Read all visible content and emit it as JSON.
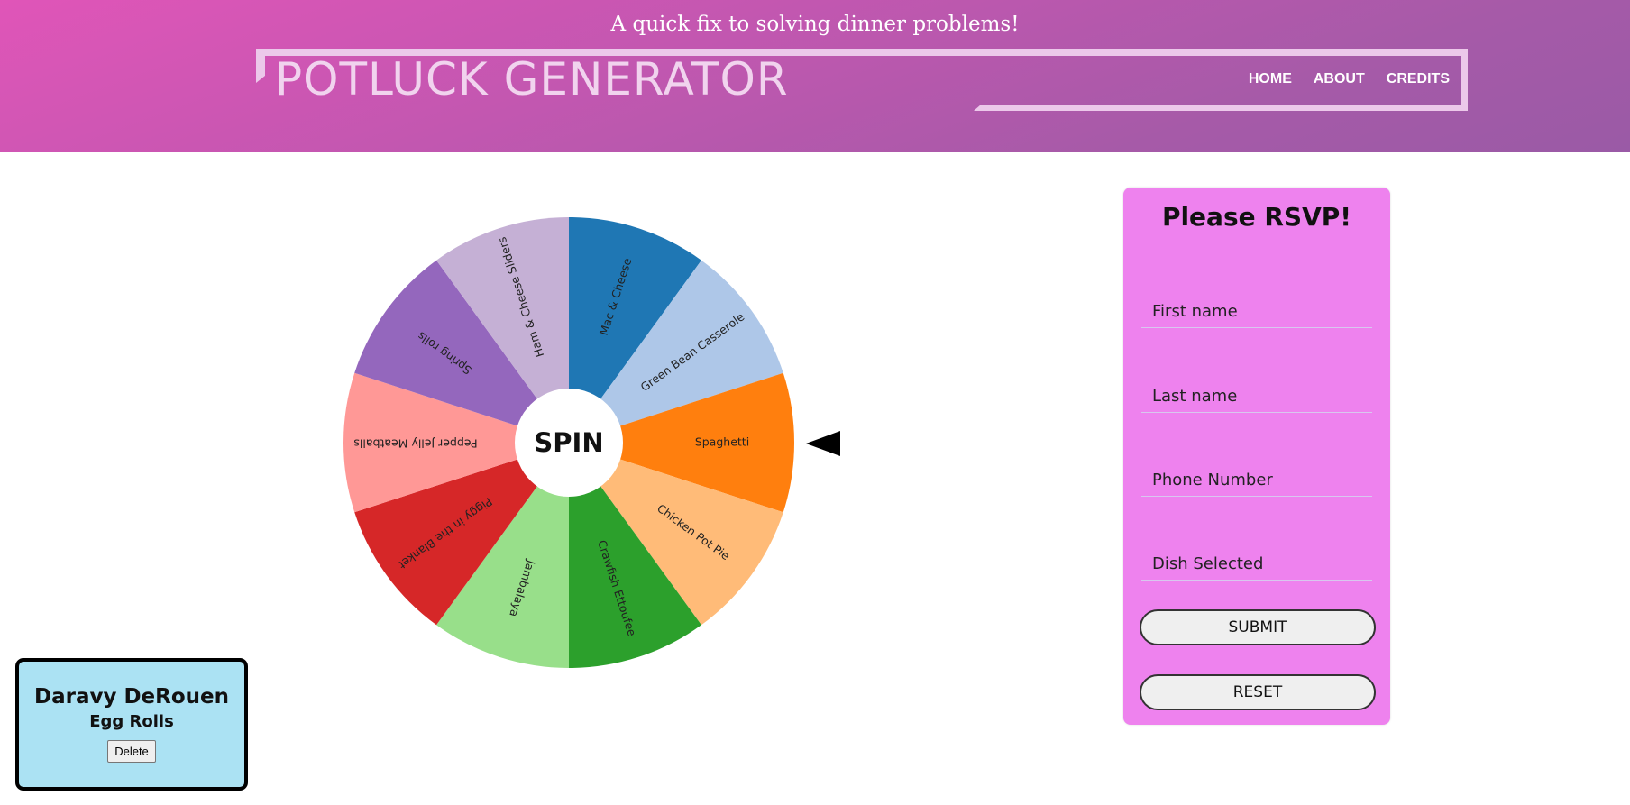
{
  "header": {
    "tagline": "A quick fix to solving dinner problems!",
    "brand": "POTLUCK GENERATOR",
    "nav": [
      "HOME",
      "ABOUT",
      "CREDITS"
    ]
  },
  "wheel": {
    "spin_label": "SPIN",
    "slices": [
      {
        "label": "Mac & Cheese",
        "color": "#1f77b4"
      },
      {
        "label": "Green Bean Casserole",
        "color": "#aec7e8"
      },
      {
        "label": "Spaghetti",
        "color": "#ff7f0e"
      },
      {
        "label": "Chicken Pot Pie",
        "color": "#ffbb78"
      },
      {
        "label": "Crawfish Ettoufee",
        "color": "#2ca02c"
      },
      {
        "label": "Jambalaya",
        "color": "#98df8a"
      },
      {
        "label": "Piggy in the Blanket",
        "color": "#d62728"
      },
      {
        "label": "Pepper Jelly Meatballs",
        "color": "#ff9896"
      },
      {
        "label": "Spring rolls",
        "color": "#9467bd"
      },
      {
        "label": "Ham & Cheese Sliders",
        "color": "#c5b0d5"
      }
    ],
    "pointer_icon": "triangle-left-icon"
  },
  "rsvp": {
    "title": "Please RSVP!",
    "first_name_placeholder": "First name",
    "last_name_placeholder": "Last name",
    "phone_placeholder": "Phone Number",
    "dish_placeholder": "Dish Selected",
    "submit_label": "SUBMIT",
    "reset_label": "RESET",
    "background": "#ee82ee"
  },
  "guest": {
    "name": "Daravy DeRouen",
    "dish": "Egg Rolls",
    "delete_label": "Delete"
  }
}
